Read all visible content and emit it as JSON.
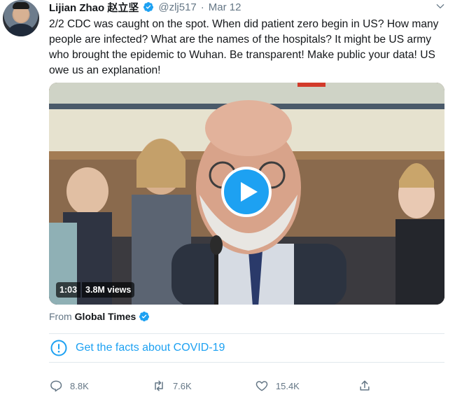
{
  "tweet": {
    "author_name": "Lijian Zhao 赵立坚",
    "handle": "@zlj517",
    "separator": "·",
    "date": "Mar 12",
    "text": "2/2 CDC was caught on the spot. When did patient zero begin in US? How many people are infected? What are the names of the hospitals? It might be US army who brought the epidemic to Wuhan. Be transparent! Make public your data! US owe us an explanation!"
  },
  "video": {
    "duration": "1:03",
    "views": "3.8M views"
  },
  "source": {
    "from_label": "From",
    "publisher": "Global Times"
  },
  "facts_banner": {
    "label": "Get the facts about COVID-19"
  },
  "actions": {
    "replies": "8.8K",
    "retweets": "7.6K",
    "likes": "15.4K"
  },
  "colors": {
    "accent": "#1da1f2",
    "text": "#14171a",
    "muted": "#657786",
    "divider": "#e1e8ed"
  },
  "icons": [
    "verified-badge-icon",
    "caret-down-icon",
    "play-icon",
    "info-icon",
    "reply-icon",
    "retweet-icon",
    "like-icon",
    "share-icon"
  ]
}
